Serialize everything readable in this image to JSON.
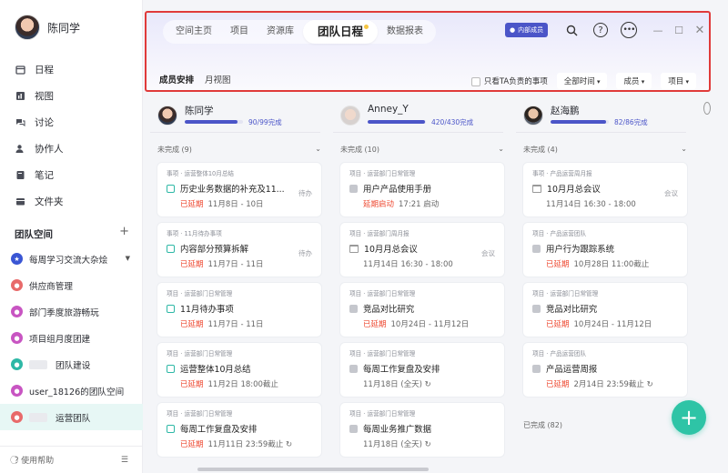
{
  "user": {
    "name": "陈同学"
  },
  "nav": [
    {
      "label": "日程",
      "icon": "calendar-icon"
    },
    {
      "label": "视图",
      "icon": "chart-icon"
    },
    {
      "label": "讨论",
      "icon": "discussion-icon"
    },
    {
      "label": "协作人",
      "icon": "people-icon"
    },
    {
      "label": "笔记",
      "icon": "note-icon"
    },
    {
      "label": "文件夹",
      "icon": "folder-icon"
    }
  ],
  "team_space": {
    "title": "团队空间",
    "add": "+"
  },
  "spaces": [
    {
      "label": "每周学习交流大杂烩",
      "color": "#3a56d4"
    },
    {
      "label": "供应商管理",
      "color": "#e86a6a"
    },
    {
      "label": "部门季度旅游畅玩",
      "color": "#c855c2"
    },
    {
      "label": "项目组月度团建",
      "color": "#c855c2"
    },
    {
      "label": "团队建设",
      "color": "#2eb8a6"
    },
    {
      "label": "user_18126的团队空间",
      "color": "#c855c2"
    },
    {
      "label": "运营团队",
      "color": "#e86a6a"
    }
  ],
  "footer": {
    "help": "使用帮助"
  },
  "topbar": {
    "tabs": [
      "空间主页",
      "项目",
      "资源库",
      "团队日程",
      "数据报表"
    ],
    "active_tab": "团队日程",
    "badge": "内部成员",
    "subtabs": [
      "成员安排",
      "月视图"
    ],
    "filter_only_mine": "只看TA负责的事项",
    "filter_time": "全部时间",
    "filter_member": "成员",
    "filter_project": "项目"
  },
  "colors": {
    "accent": "#4b55c8",
    "teal": "#2eb8a6",
    "late": "#ee4a32",
    "fab": "#2ec4a6"
  },
  "columns": [
    {
      "name": "陈同学",
      "progress": "90/99完成",
      "progress_value": 0.909,
      "group": "未完成 (9)",
      "cards": [
        {
          "crumb": "事项 · 运营整体10月总结",
          "title": "历史业务数据的补充及11...",
          "kind": "check",
          "late": "已延期",
          "date": "11月8日 - 10日",
          "tag": "待办"
        },
        {
          "crumb": "事项 · 11月待办事项",
          "title": "内容部分预算拆解",
          "kind": "check",
          "late": "已延期",
          "date": "11月7日 - 11日",
          "tag": "待办"
        },
        {
          "crumb": "项目 · 运营部门日常管理",
          "title": "11月待办事项",
          "kind": "check",
          "late": "已延期",
          "date": "11月7日 - 11日",
          "tag": ""
        },
        {
          "crumb": "项目 · 运营部门日常管理",
          "title": "运营整体10月总结",
          "kind": "check",
          "late": "已延期",
          "date": "11月2日 18:00截止",
          "tag": ""
        },
        {
          "crumb": "项目 · 运营部门日常管理",
          "title": "每周工作复盘及安排",
          "kind": "check",
          "late": "已延期",
          "date": "11月11日 23:59截止 ↻",
          "tag": ""
        }
      ]
    },
    {
      "name": "Anney_Y",
      "progress": "420/430完成",
      "progress_value": 0.977,
      "group": "未完成 (10)",
      "cards": [
        {
          "crumb": "项目 · 运营部门日常管理",
          "title": "用户产品使用手册",
          "kind": "grey",
          "late": "延期启动",
          "date": "17:21 启动",
          "tag": ""
        },
        {
          "crumb": "项目 · 运营部门周月报",
          "title": "10月月总会议",
          "kind": "cal",
          "late": "",
          "date": "11月14日 16:30 - 18:00",
          "tag": "会议"
        },
        {
          "crumb": "项目 · 运营部门日常管理",
          "title": "竞品对比研究",
          "kind": "grey",
          "late": "已延期",
          "date": "10月24日 - 11月12日",
          "tag": ""
        },
        {
          "crumb": "项目 · 运营部门日常管理",
          "title": "每周工作复盘及安排",
          "kind": "grey",
          "late": "",
          "date": "11月18日 (全天) ↻",
          "tag": ""
        },
        {
          "crumb": "项目 · 运营部门日常管理",
          "title": "每周业务推广数据",
          "kind": "grey",
          "late": "",
          "date": "11月18日 (全天) ↻",
          "tag": ""
        }
      ]
    },
    {
      "name": "赵海鹏",
      "progress": "82/86完成",
      "progress_value": 0.953,
      "group": "未完成 (4)",
      "cards": [
        {
          "crumb": "事项 · 产品运营周月报",
          "title": "10月月总会议",
          "kind": "cal",
          "late": "",
          "date": "11月14日 16:30 - 18:00",
          "tag": "会议"
        },
        {
          "crumb": "项目 · 产品运营团队",
          "title": "用户行为跟踪系统",
          "kind": "grey",
          "late": "已延期",
          "date": "10月28日 11:00截止",
          "tag": ""
        },
        {
          "crumb": "项目 · 运营部门日常管理",
          "title": "竞品对比研究",
          "kind": "grey",
          "late": "已延期",
          "date": "10月24日 - 11月12日",
          "tag": ""
        },
        {
          "crumb": "项目 · 产品运营团队",
          "title": "产品运营周报",
          "kind": "grey",
          "late": "已延期",
          "date": "2月14日 23:59截止 ↻",
          "tag": ""
        }
      ],
      "done_group": "已完成 (82)"
    }
  ]
}
